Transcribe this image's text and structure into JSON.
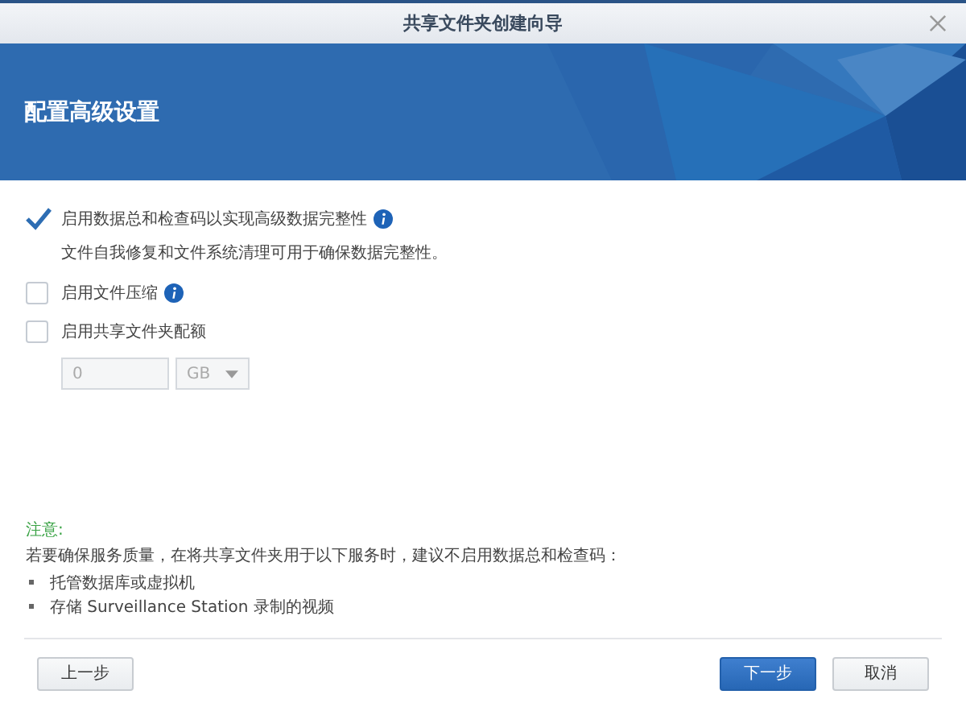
{
  "window": {
    "title": "共享文件夹创建向导"
  },
  "banner": {
    "heading": "配置高级设置"
  },
  "options": [
    {
      "label": "启用数据总和检查码以实现高级数据完整性",
      "checked": true,
      "info": true,
      "description": "文件自我修复和文件系统清理可用于确保数据完整性。"
    },
    {
      "label": "启用文件压缩",
      "checked": false,
      "info": true
    },
    {
      "label": "启用共享文件夹配额",
      "checked": false,
      "info": false
    }
  ],
  "quota": {
    "value": "0",
    "unit": "GB",
    "disabled": true
  },
  "note": {
    "title": "注意:",
    "text": "若要确保服务质量，在将共享文件夹用于以下服务时，建议不启用数据总和检查码：",
    "items": [
      "托管数据库或虚拟机",
      "存储 Surveillance Station 录制的视频"
    ]
  },
  "buttons": [
    {
      "label": "上一步",
      "kind": "secondary"
    },
    {
      "label": "下一步",
      "kind": "primary"
    },
    {
      "label": "取消",
      "kind": "secondary"
    }
  ]
}
